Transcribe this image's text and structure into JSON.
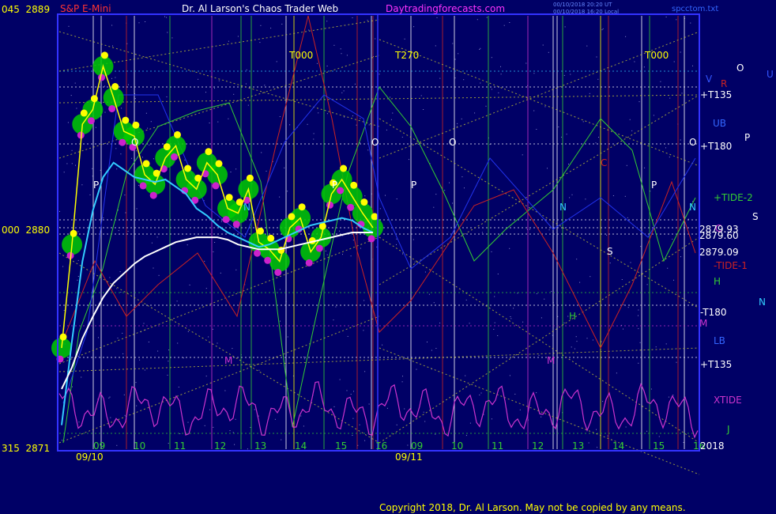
{
  "header": {
    "symbol": "S&P E-Mini",
    "title": "Dr. Al Larson's Chaos Trader Web",
    "site": "Daytradingforecasts.com",
    "stamp1": "00/10/2018 20:20 UT",
    "stamp2": "00/10/2018 16:20 Local",
    "file": "spcctom.txt"
  },
  "footer": {
    "copyright": "Copyright 2018, Dr. Al Larson. May not be copied by any means."
  },
  "colors": {
    "background": "#000066",
    "frame": "#3333ff",
    "price": "#ffff00",
    "ema_fast": "#33ccff",
    "ema_slow": "#ffffff",
    "xtide": "#cc33cc",
    "tide_green": "#33cc33",
    "tide_red": "#cc2222",
    "tide_blue": "#2233ee",
    "dots_up": "#ffff00",
    "dots_down": "#cc22cc",
    "cloud": "#00cc00"
  },
  "chart_data": {
    "type": "line",
    "title": "S&P E-Mini",
    "ylim": [
      2871,
      2889
    ],
    "y_labels_left": [
      {
        "label": "045  2889",
        "value": 2889
      },
      {
        "label": "000  2880",
        "value": 2880
      },
      {
        "label": "315  2871",
        "value": 2871
      }
    ],
    "x_ticks_day1": [
      "09",
      "10",
      "11",
      "12",
      "13",
      "14",
      "15",
      "16"
    ],
    "x_ticks_day2": [
      "09",
      "10",
      "11",
      "12",
      "13",
      "14",
      "15",
      "16"
    ],
    "dates": [
      "09/10",
      "09/11"
    ],
    "vertical_markers": [
      "T000",
      "T270",
      "T000"
    ],
    "right_labels": [
      {
        "text": "V",
        "color": "#3355ff"
      },
      {
        "text": "R",
        "color": "#cc2222"
      },
      {
        "text": "O",
        "color": "#ffffff"
      },
      {
        "text": "U",
        "color": "#3355ff"
      },
      {
        "text": "+T135",
        "color": "#ffffff"
      },
      {
        "text": "UB",
        "color": "#3366ff"
      },
      {
        "text": "P",
        "color": "#ffffff"
      },
      {
        "text": "+T180",
        "color": "#ffffff"
      },
      {
        "text": "+TIDE-2",
        "color": "#33cc33"
      },
      {
        "text": "S",
        "color": "#ffffff"
      },
      {
        "text": "C",
        "color": "#cc33cc"
      },
      {
        "text": "2879.93",
        "color": "#ffffff"
      },
      {
        "text": "2879.60",
        "color": "#ffffff"
      },
      {
        "text": "2879.09",
        "color": "#ffffff"
      },
      {
        "text": "-TIDE-1",
        "color": "#cc2222"
      },
      {
        "text": "H",
        "color": "#33cc33"
      },
      {
        "text": "N",
        "color": "#33ccff"
      },
      {
        "text": "-T180",
        "color": "#ffffff"
      },
      {
        "text": "M",
        "color": "#cc33cc"
      },
      {
        "text": "LB",
        "color": "#3366ff"
      },
      {
        "text": "+T135",
        "color": "#ffffff"
      },
      {
        "text": "XTIDE",
        "color": "#cc33cc"
      },
      {
        "text": "J",
        "color": "#33cc33"
      },
      {
        "text": "2018",
        "color": "#ffffff"
      }
    ],
    "in_chart_labels": [
      "O",
      "P",
      "N",
      "M",
      "O",
      "P",
      "O",
      "H",
      "M",
      "S",
      "C",
      "N",
      "P",
      "O",
      "P",
      "N"
    ],
    "series": [
      {
        "name": "price",
        "values": [
          2875.2,
          2879.5,
          2884.5,
          2885.1,
          2886.9,
          2885.6,
          2884.2,
          2884.0,
          2882.4,
          2882.0,
          2883.1,
          2883.6,
          2882.2,
          2881.8,
          2882.9,
          2882.4,
          2881.0,
          2880.8,
          2881.8,
          2879.6,
          2879.3,
          2878.8,
          2880.2,
          2880.6,
          2879.2,
          2879.8,
          2881.6,
          2882.2,
          2881.5,
          2880.8,
          2880.2
        ]
      },
      {
        "name": "ema-fast",
        "values": [
          2872.0,
          2875.5,
          2878.8,
          2880.9,
          2882.3,
          2882.9,
          2882.6,
          2882.3,
          2882.2,
          2882.1,
          2882.2,
          2881.9,
          2881.6,
          2881.0,
          2880.7,
          2880.3,
          2880.0,
          2879.8,
          2879.6,
          2879.4,
          2879.5,
          2879.7,
          2879.9,
          2880.1,
          2880.3,
          2880.4,
          2880.5,
          2880.6,
          2880.5,
          2880.2,
          2880.0
        ]
      },
      {
        "name": "ema-slow",
        "values": [
          2873.5,
          2874.4,
          2875.6,
          2876.5,
          2877.3,
          2877.9,
          2878.3,
          2878.7,
          2879.0,
          2879.2,
          2879.4,
          2879.6,
          2879.7,
          2879.8,
          2879.8,
          2879.8,
          2879.7,
          2879.5,
          2879.4,
          2879.3,
          2879.3,
          2879.3,
          2879.4,
          2879.5,
          2879.6,
          2879.7,
          2879.8,
          2879.9,
          2880.0,
          2880.0,
          2880.0
        ]
      }
    ]
  }
}
